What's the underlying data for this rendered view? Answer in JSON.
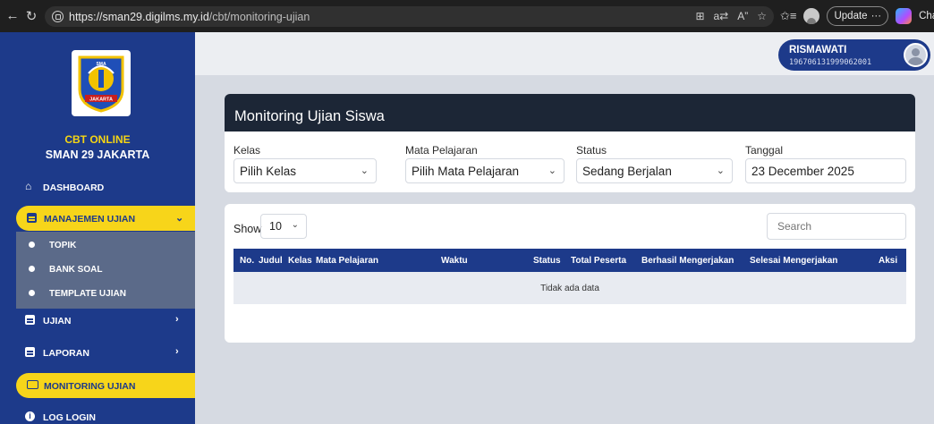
{
  "browser": {
    "url_host": "https://sman29.digilms.my.id",
    "url_path": "/cbt/monitoring-ujian",
    "update_label": "Update",
    "update_more": "···",
    "copilot_label": "Cha"
  },
  "sidebar": {
    "app_title": "CBT ONLINE",
    "school_name": "SMAN 29 JAKARTA",
    "logo_text": "SMA JAKARTA",
    "items": [
      {
        "label": "DASHBOARD"
      },
      {
        "label": "MANAJEMEN UJIAN"
      },
      {
        "label": "UJIAN"
      },
      {
        "label": "LAPORAN"
      },
      {
        "label": "MONITORING UJIAN"
      },
      {
        "label": "LOG LOGIN"
      }
    ],
    "submenu": [
      {
        "label": "TOPIK"
      },
      {
        "label": "BANK SOAL"
      },
      {
        "label": "TEMPLATE UJIAN"
      }
    ]
  },
  "user": {
    "name": "RISMAWATI",
    "id": "196706131999062001"
  },
  "page": {
    "title": "Monitoring Ujian Siswa"
  },
  "filters": {
    "kelas": {
      "label": "Kelas",
      "value": "Pilih Kelas"
    },
    "mapel": {
      "label": "Mata Pelajaran",
      "value": "Pilih Mata Pelajaran"
    },
    "status": {
      "label": "Status",
      "value": "Sedang Berjalan"
    },
    "tanggal": {
      "label": "Tanggal",
      "value": "23 December 2025"
    }
  },
  "table": {
    "show_label": "Show",
    "page_size": "10",
    "search_placeholder": "Search",
    "columns": [
      "No.",
      "Judul",
      "Kelas",
      "Mata Pelajaran",
      "Waktu",
      "Status",
      "Total Peserta",
      "Berhasil Mengerjakan",
      "Selesai Mengerjakan",
      "Aksi"
    ],
    "empty_text": "Tidak ada data"
  },
  "colors": {
    "sidebar": "#1d3a8a",
    "accent": "#f7d51a",
    "header": "#1c2636"
  }
}
